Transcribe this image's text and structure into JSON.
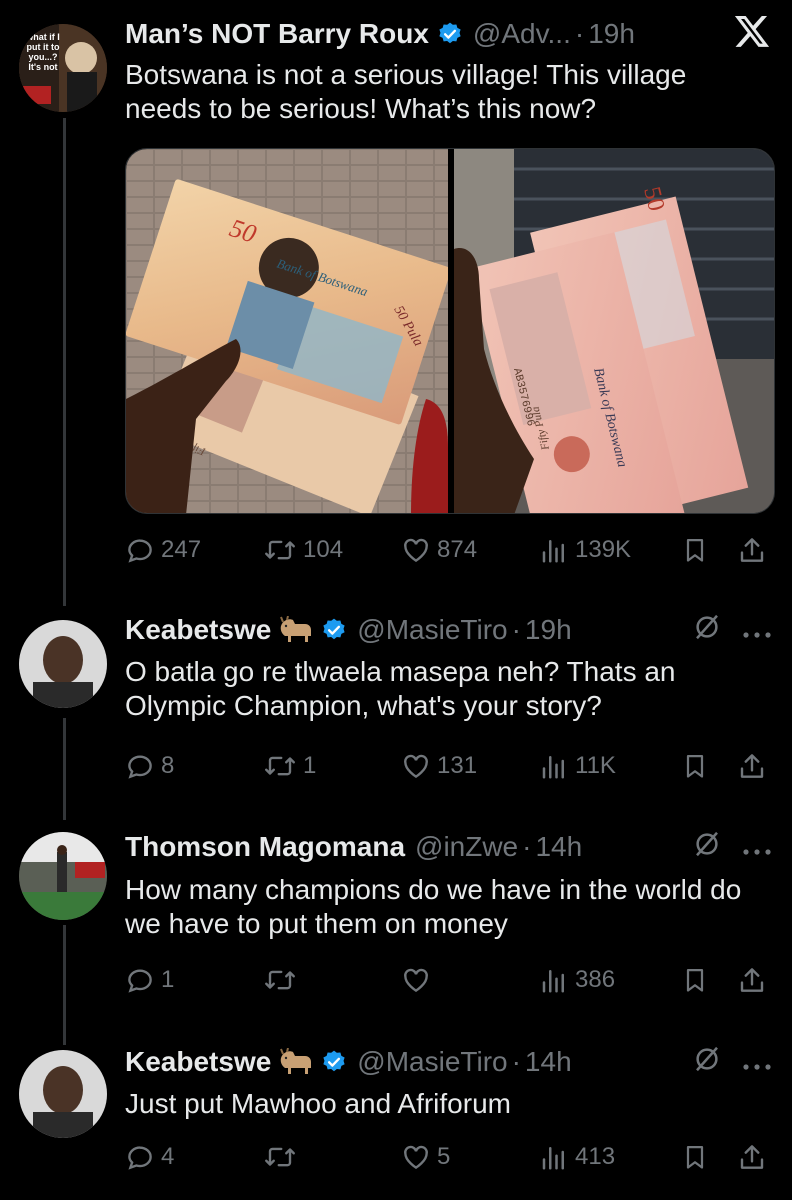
{
  "colors": {
    "background": "#000000",
    "text": "#e7e9ea",
    "muted": "#71767b",
    "verified": "#1d9bf0",
    "divider": "#333639"
  },
  "header": {
    "platform_icon": "x-logo-icon"
  },
  "posts": [
    {
      "name": "Man’s NOT Barry Roux",
      "handle": "@Adv...",
      "sep": "·",
      "time": "19h",
      "avatar_caption": "what if I put it to you...? It's not",
      "text": "Botswana is not a serious village! This village needs to be serious! What’s this now?",
      "media": {
        "left_note": {
          "denom": "50",
          "brand": "Bank of Botswana",
          "denom_word": "50 Pula",
          "serial": "Fifty Pula"
        },
        "right_note": {
          "denom": "50",
          "brand": "Bank of Botswana",
          "serial": "AB3576996",
          "denom_word": "Fifty Pula"
        }
      },
      "stats": {
        "replies": "247",
        "reposts": "104",
        "likes": "874",
        "views": "139K"
      }
    },
    {
      "name": "Keabetswe",
      "handle": "@MasieTiro",
      "sep": "·",
      "time": "19h",
      "emoji": "goat-emoji",
      "text": "O batla go re tlwaela masepa neh? Thats an Olympic Champion, what's your story?",
      "stats": {
        "replies": "8",
        "reposts": "1",
        "likes": "131",
        "views": "11K"
      }
    },
    {
      "name": "Thomson Magomana",
      "handle": "@inZwe",
      "sep": "·",
      "time": "14h",
      "text": "How many champions do we have in the world do we have to put them on money",
      "stats": {
        "replies": "1",
        "reposts": "",
        "likes": "",
        "views": "386"
      }
    },
    {
      "name": "Keabetswe",
      "handle": "@MasieTiro",
      "sep": "·",
      "time": "14h",
      "emoji": "goat-emoji",
      "text": "Just put Mawhoo and Afriforum",
      "stats": {
        "replies": "4",
        "reposts": "",
        "likes": "5",
        "views": "413"
      }
    }
  ]
}
